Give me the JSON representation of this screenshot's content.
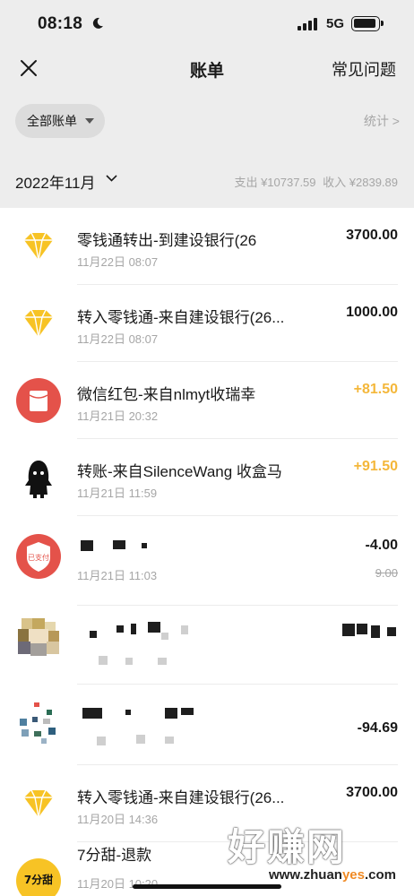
{
  "status_bar": {
    "time": "08:18",
    "network": "5G"
  },
  "nav": {
    "title": "账单",
    "faq_label": "常见问题"
  },
  "filter": {
    "label": "全部账单",
    "stats_label": "统计 >"
  },
  "month_bar": {
    "month": "2022年11月",
    "expense": "支出 ¥10737.59",
    "income": "收入 ¥2839.89"
  },
  "colors": {
    "income": "#f4b73a",
    "diamond": "#f7c325",
    "red_packet": "#e4524a"
  },
  "transactions": [
    {
      "icon": "diamond-icon",
      "title": "零钱通转出-到建设银行(26",
      "date": "11月22日 08:07",
      "amount": "3700.00"
    },
    {
      "icon": "diamond-icon",
      "title": "转入零钱通-来自建设银行(26...",
      "date": "11月22日 08:07",
      "amount": "1000.00"
    },
    {
      "icon": "red-packet-icon",
      "title": "微信红包-来自nlmyt收瑞幸",
      "date": "11月21日 20:32",
      "amount": "+81.50"
    },
    {
      "icon": "avatar-icon",
      "title": "转账-来自SilenceWang 收盒马",
      "date": "11月21日 11:59",
      "amount": "+91.50"
    },
    {
      "icon": "pay-shield-icon",
      "title": "",
      "date": "11月21日 11:03",
      "amount": "-4.00",
      "original": "9.00"
    },
    {
      "icon": "pixel-avatar-icon",
      "title": "",
      "date": "",
      "amount": ""
    },
    {
      "icon": "pixel-logo-icon",
      "title": "",
      "date": "",
      "amount": "-94.69"
    },
    {
      "icon": "diamond-icon",
      "title": "转入零钱通-来自建设银行(26...",
      "date": "11月20日 14:36",
      "amount": "3700.00"
    },
    {
      "icon": "store-logo-icon",
      "title": "7分甜-退款",
      "date": "11月20日 10:20",
      "amount": ""
    }
  ],
  "store_logo_text": "7分甜",
  "pay_badge_text": "已支付",
  "watermark": {
    "big": "好赚网",
    "small_prefix": "www.zhuan",
    "small_accent": "yes",
    "small_suffix": ".com"
  }
}
